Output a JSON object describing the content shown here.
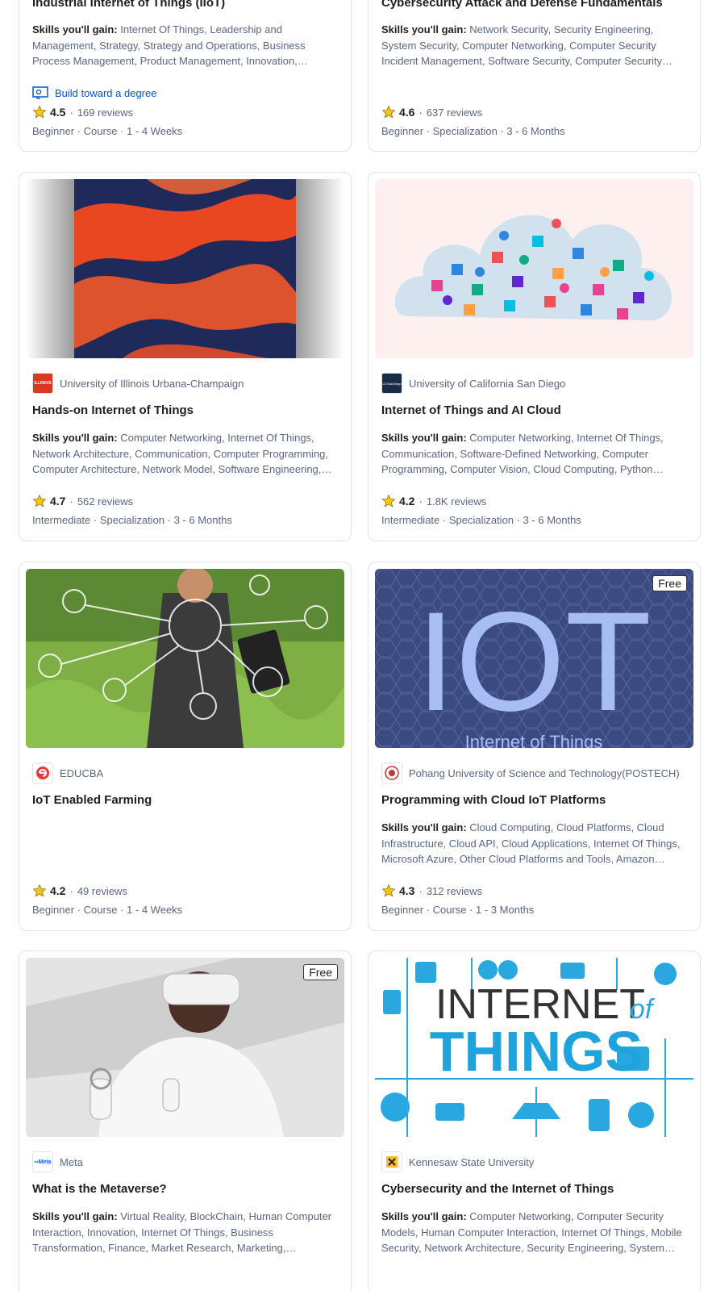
{
  "cards": [
    {
      "title": "Industrial Internet of Things (IIoT)",
      "skills_label": "Skills you'll gain:",
      "skills": "Internet Of Things, Leadership and Management, Strategy, Strategy and Operations, Business Process Management, Product Management, Innovation, Operations…",
      "degree_link": "Build toward a degree",
      "rating": "4.5",
      "reviews": "169 reviews",
      "meta": "Beginner · Course · 1 - 4 Weeks"
    },
    {
      "title": "Cybersecurity Attack and Defense Fundamentals",
      "skills_label": "Skills you'll gain:",
      "skills": "Network Security, Security Engineering, System Security, Computer Networking, Computer Security Incident Management, Software Security, Computer Security Models,…",
      "rating": "4.6",
      "reviews": "637 reviews",
      "meta": "Beginner · Specialization · 3 - 6 Months"
    },
    {
      "partner": "University of Illinois Urbana-Champaign",
      "partner_logo_text": "ILLINOIS",
      "title": "Hands-on Internet of Things",
      "skills_label": "Skills you'll gain:",
      "skills": "Computer Networking, Internet Of Things, Network Architecture, Communication, Computer Programming, Computer Architecture, Network Model, Software Engineering,…",
      "rating": "4.7",
      "reviews": "562 reviews",
      "meta": "Intermediate · Specialization · 3 - 6 Months"
    },
    {
      "partner": "University of California San Diego",
      "partner_logo_text": "UCSanDiego",
      "title": "Internet of Things and AI Cloud",
      "skills_label": "Skills you'll gain:",
      "skills": "Computer Networking, Internet Of Things, Communication, Software-Defined Networking, Computer Programming, Computer Vision, Cloud Computing, Python…",
      "rating": "4.2",
      "reviews": "1.8K reviews",
      "meta": "Intermediate · Specialization · 3 - 6 Months"
    },
    {
      "partner": "EDUCBA",
      "title": "IoT Enabled Farming",
      "rating": "4.2",
      "reviews": "49 reviews",
      "meta": "Beginner · Course · 1 - 4 Weeks"
    },
    {
      "badge": "Free",
      "image_text": "IOT",
      "image_subtext": "Internet of Things",
      "partner": "Pohang University of Science and Technology(POSTECH)",
      "title": "Programming with Cloud IoT Platforms",
      "skills_label": "Skills you'll gain:",
      "skills": "Cloud Computing, Cloud Platforms, Cloud Infrastructure, Cloud API, Cloud Applications, Internet Of Things, Microsoft Azure, Other Cloud Platforms and Tools, Amazon Web…",
      "rating": "4.3",
      "reviews": "312 reviews",
      "meta": "Beginner · Course · 1 - 3 Months"
    },
    {
      "badge": "Free",
      "partner": "Meta",
      "partner_logo_text": "∞Meta",
      "title": "What is the Metaverse?",
      "skills_label": "Skills you'll gain:",
      "skills": "Virtual Reality, BlockChain, Human Computer Interaction, Innovation, Internet Of Things, Business Transformation, Finance, Market Research, Marketing,…"
    },
    {
      "image_text_1": "INTERNET",
      "image_text_2": "of",
      "image_text_3": "THINGS",
      "partner": "Kennesaw State University",
      "title": "Cybersecurity and the Internet of Things",
      "skills_label": "Skills you'll gain:",
      "skills": "Computer Networking, Computer Security Models, Human Computer Interaction, Internet Of Things, Mobile Security, Network Architecture, Security Engineering, System…"
    }
  ],
  "colors": {
    "link": "#0056d2",
    "muted": "#5b6780",
    "star": "#f5c518",
    "border": "#dfe3ea"
  }
}
